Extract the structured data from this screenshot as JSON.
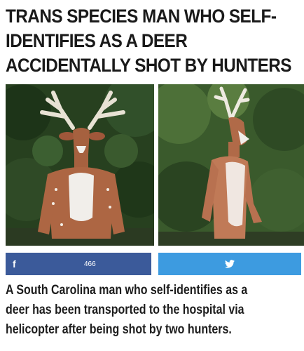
{
  "headline": {
    "lines": [
      "TRANS SPECIES MAN WHO SELF-",
      "IDENTIFIES AS A DEER",
      "ACCIDENTALLY SHOT BY HUNTERS"
    ]
  },
  "share": {
    "facebook": {
      "icon": "facebook-icon",
      "glyph": "f",
      "count": "466",
      "color": "#3b5a9a"
    },
    "twitter": {
      "icon": "twitter-icon",
      "color": "#3d9be0"
    }
  },
  "body": {
    "lines": [
      "A South Carolina man who self-identifies as a",
      "deer has been transported to the hospital via",
      "helicopter after being shot by two hunters."
    ]
  }
}
